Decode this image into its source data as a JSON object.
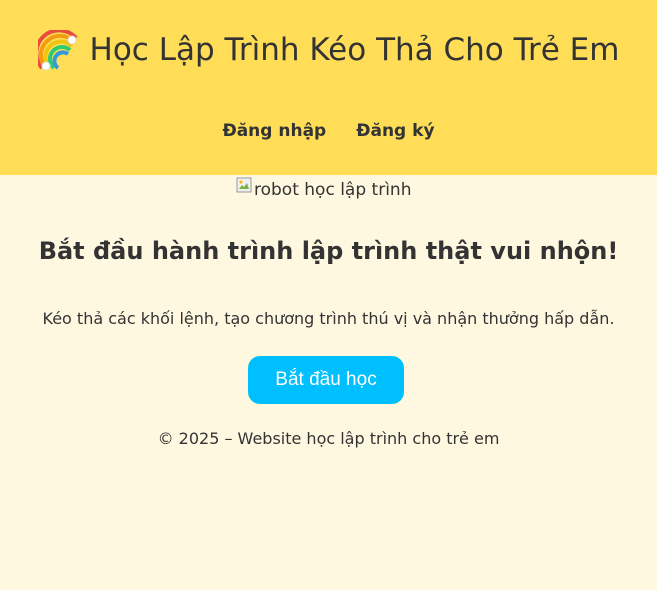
{
  "header": {
    "title": "Học Lập Trình Kéo Thả Cho Trẻ Em",
    "title_icon": "rainbow-icon",
    "nav": [
      {
        "label": "Đăng nhập"
      },
      {
        "label": "Đăng ký"
      }
    ],
    "background_color": "#ffdd57"
  },
  "hero": {
    "image_alt": "robot học lập trình",
    "image_icon": "broken-image-icon",
    "title": "Bắt đầu hành trình lập trình thật vui nhộn!",
    "description": "Kéo thả các khối lệnh, tạo chương trình thú vị và nhận thưởng hấp dẫn.",
    "start_label": "Bắt đầu học",
    "button_color": "#00bfff"
  },
  "footer": {
    "text": "© 2025 – Website học lập trình cho trẻ em"
  },
  "page_background": "#fff8e1"
}
